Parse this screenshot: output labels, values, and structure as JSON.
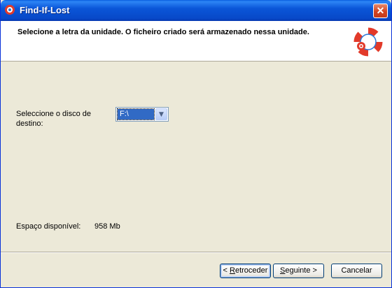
{
  "window": {
    "title": "Find-If-Lost",
    "close_label": "✕",
    "app_icon": "lifebuoy-icon"
  },
  "header": {
    "instruction": "Selecione a letra da unidade. O ficheiro criado será armazenado nessa unidade.",
    "logo_icon": "lifebuoy-icon"
  },
  "form": {
    "destination_label": "Seleccione o disco de destino:",
    "drive_value": "F:\\",
    "space_label": "Espaço disponível:",
    "space_value": "958 Mb"
  },
  "buttons": {
    "back_prefix": "< ",
    "back_mnemonic": "R",
    "back_rest": "etroceder",
    "next_mnemonic": "S",
    "next_rest": "eguinte >",
    "cancel": "Cancelar"
  },
  "colors": {
    "titlebar": "#0a56d8",
    "dialog_bg": "#ece9d8",
    "selection": "#316ac5",
    "lifebuoy_red": "#e23a2a",
    "lifebuoy_blue": "#2a78d8"
  }
}
